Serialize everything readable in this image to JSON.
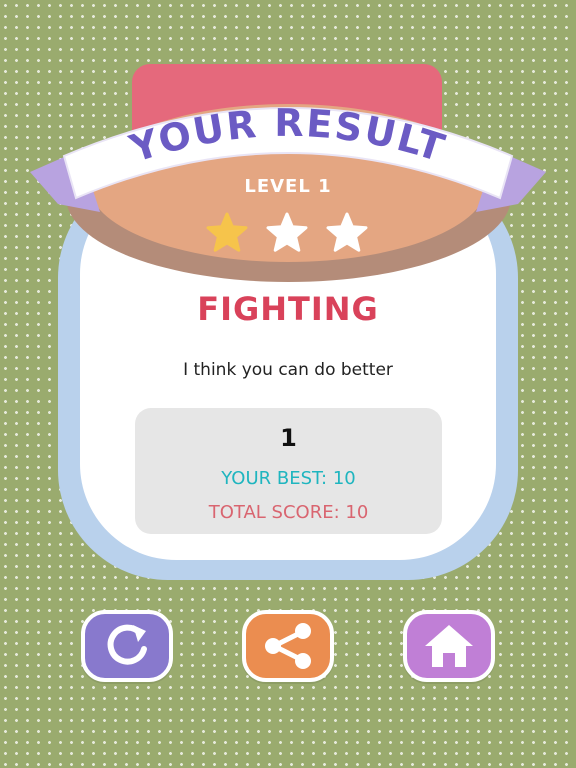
{
  "result": {
    "banner_title": "YOUR RESULT",
    "level_label": "LEVEL 1",
    "stars_earned": 1,
    "stars_total": 3,
    "rank_title": "FIGHTING",
    "message": "I think you can do better",
    "score": "1",
    "best_score_text": "YOUR BEST: 10",
    "total_score_text": "TOTAL SCORE: 10"
  },
  "colors": {
    "background": "#9aab6e",
    "lid": "#e5697c",
    "ribbon_text": "#6b5bc4",
    "ribbon_fold": "#b8a3e0",
    "star_filled": "#f6c44b",
    "star_empty": "#ffffff",
    "rank_title": "#d9425a",
    "best_score": "#1fb5bf",
    "total_score": "#d96570",
    "replay_button": "#8879cd",
    "share_button": "#eb8d50",
    "home_button": "#c07fd6"
  },
  "buttons": [
    {
      "name": "replay",
      "icon": "replay-icon"
    },
    {
      "name": "share",
      "icon": "share-icon"
    },
    {
      "name": "home",
      "icon": "home-icon"
    }
  ]
}
